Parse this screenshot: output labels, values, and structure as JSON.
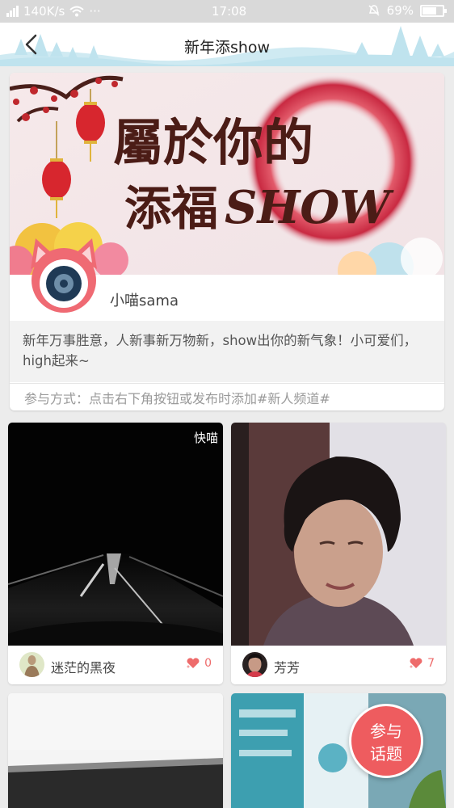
{
  "status_bar": {
    "network_speed": "140K/s",
    "dots": "···",
    "time": "17:08",
    "battery": "69%",
    "battery_level": 0.69,
    "icons": [
      "signal-icon",
      "wifi-icon",
      "mute-icon",
      "battery-icon"
    ]
  },
  "header": {
    "title": "新年添show",
    "back_icon": "chevron-left-icon"
  },
  "banner": {
    "line1": "屬於你的",
    "line2_cn": "添福",
    "line2_en": "SHOW",
    "author": "小喵sama",
    "description": "新年万事胜意，人新事新万物新，show出你的新气象！小可爱们，high起来~",
    "howto": "参与方式：点击右下角按钮或发布时添加#新人频道#"
  },
  "posts": [
    {
      "name": "迷茫的黑夜",
      "likes": "0",
      "watermark": "快喵"
    },
    {
      "name": "芳芳",
      "likes": "7",
      "watermark": ""
    }
  ],
  "fab": {
    "line1": "参与",
    "line2": "话题"
  },
  "colors": {
    "accent": "#ee5c5f",
    "like": "#ee6b6b",
    "header_deco": "#bfe3ee"
  }
}
